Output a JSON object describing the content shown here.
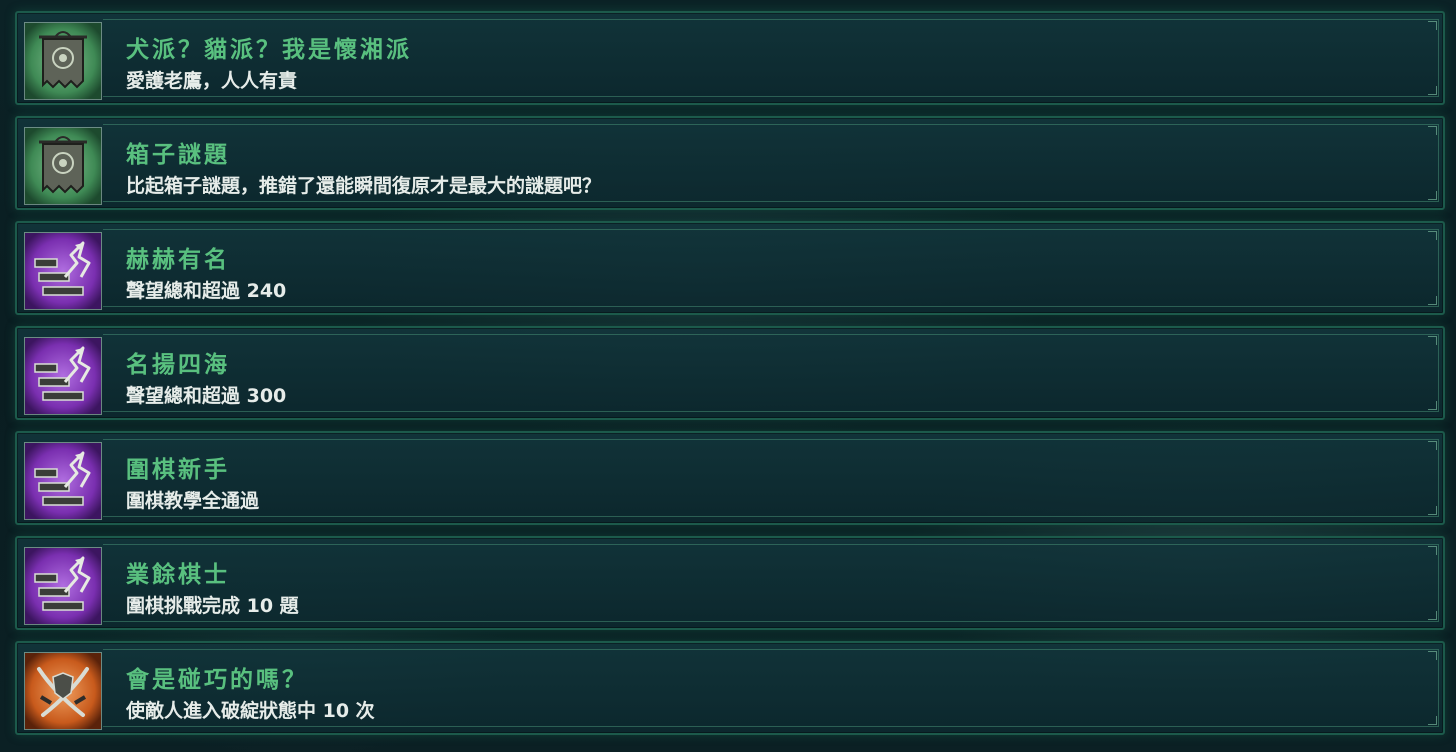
{
  "achievements": [
    {
      "title": "犬派？貓派？我是懷湘派",
      "description": "愛護老鷹，人人有責",
      "icon": "banner-icon",
      "icon_theme": "green"
    },
    {
      "title": "箱子謎題",
      "description": "比起箱子謎題，推錯了還能瞬間復原才是最大的謎題吧？",
      "icon": "banner-icon",
      "icon_theme": "green"
    },
    {
      "title": "赫赫有名",
      "description": "聲望總和超過 240",
      "icon": "stairs-arrow-icon",
      "icon_theme": "purple"
    },
    {
      "title": "名揚四海",
      "description": "聲望總和超過 300",
      "icon": "stairs-arrow-icon",
      "icon_theme": "purple"
    },
    {
      "title": "圍棋新手",
      "description": "圍棋教學全通過",
      "icon": "stairs-arrow-icon",
      "icon_theme": "purple"
    },
    {
      "title": "業餘棋士",
      "description": "圍棋挑戰完成 10 題",
      "icon": "stairs-arrow-icon",
      "icon_theme": "purple"
    },
    {
      "title": "會是碰巧的嗎？",
      "description": "使敵人進入破綻狀態中 10 次",
      "icon": "crossed-swords-icon",
      "icon_theme": "orange"
    }
  ],
  "colors": {
    "title_green": "#59c07f",
    "description_white": "#e6ece9",
    "row_border": "#1c5a4b",
    "icon_green": "#3f8a55",
    "icon_purple": "#7a2fb0",
    "icon_orange": "#c85a1c"
  }
}
